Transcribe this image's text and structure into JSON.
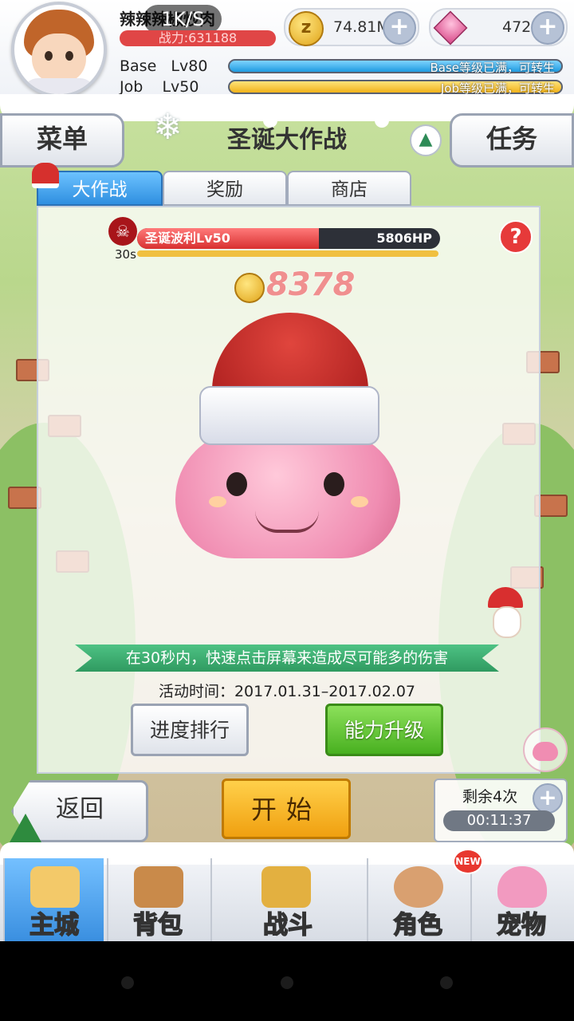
{
  "player": {
    "name": "辣辣辣椒炒肉",
    "net_speed": "1K/S",
    "power": "战力:631188",
    "zeny": "74.81M",
    "gems": "472",
    "base_label": "Base",
    "base_level": "Lv80",
    "base_status": "Base等级已满，可转生",
    "job_label": "Job",
    "job_level": "Lv50",
    "job_status": "Job等级已满，可转生"
  },
  "header": {
    "menu_left": "菜单",
    "title": "圣诞大作战",
    "menu_right": "任务"
  },
  "tabs": [
    "大作战",
    "奖励",
    "商店"
  ],
  "boss": {
    "name": "圣诞波利Lv50",
    "hp": "5806HP",
    "hp_fraction": 0.6,
    "timer": "30s",
    "help": "?",
    "score": "8378"
  },
  "event": {
    "instruction": "在30秒内，快速点击屏幕来造成尽可能多的伤害",
    "period": "活动时间：2017.01.31–2017.02.07",
    "rank_button": "进度排行",
    "upgrade_button": "能力升级"
  },
  "actions": {
    "back": "返回",
    "start": "开始",
    "remaining": "剩余4次",
    "countdown": "00:11:37"
  },
  "nav": {
    "items": [
      "主城",
      "背包",
      "战斗",
      "角色",
      "宠物"
    ],
    "new_badge": "NEW"
  }
}
